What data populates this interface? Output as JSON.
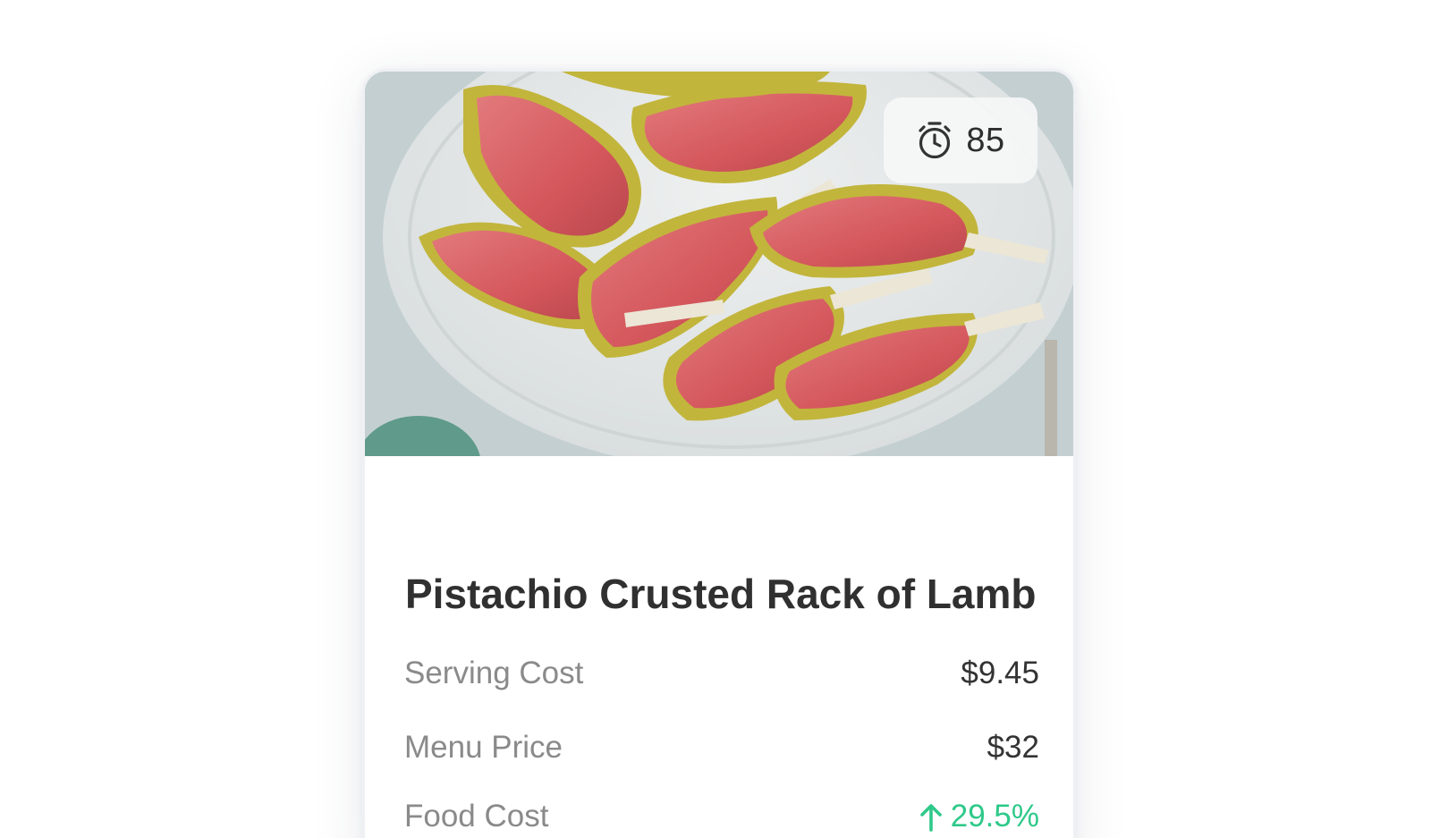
{
  "recipe_card": {
    "timer": {
      "icon": "stopwatch-icon",
      "value": "85"
    },
    "title": "Pistachio Crusted Rack of Lamb",
    "stats": {
      "serving_cost": {
        "label": "Serving Cost",
        "value": "$9.45"
      },
      "menu_price": {
        "label": "Menu Price",
        "value": "$32"
      },
      "food_cost": {
        "label": "Food Cost",
        "value": "29.5%",
        "trend_icon": "arrow-up-icon",
        "trend_color": "#2ec98a"
      }
    }
  }
}
